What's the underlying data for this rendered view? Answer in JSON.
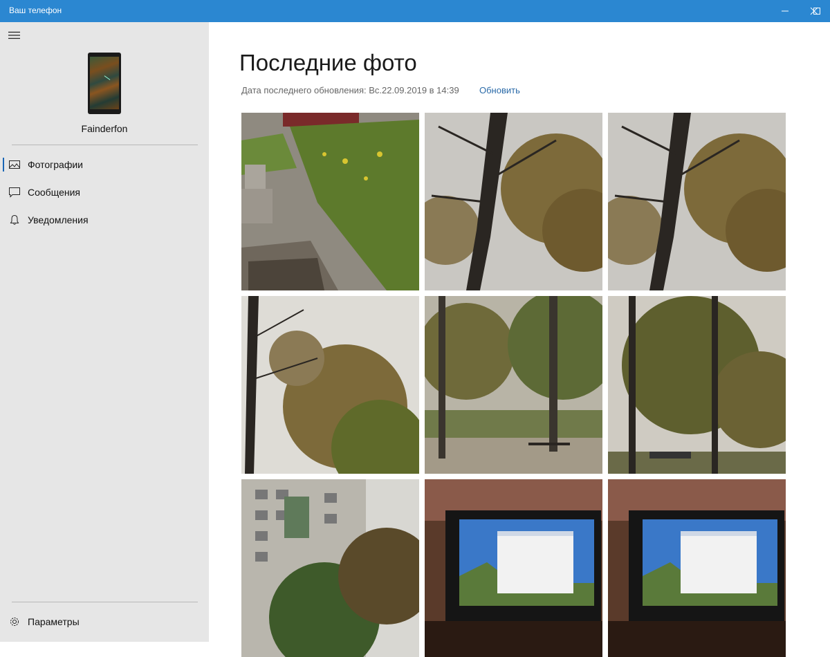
{
  "window": {
    "title": "Ваш телефон"
  },
  "sidebar": {
    "device_name": "Fainderfon",
    "items": [
      {
        "label": "Фотографии",
        "icon": "photos-icon"
      },
      {
        "label": "Сообщения",
        "icon": "messages-icon"
      },
      {
        "label": "Уведомления",
        "icon": "notifications-icon"
      }
    ],
    "settings_label": "Параметры"
  },
  "main": {
    "title": "Последние фото",
    "updated_text": "Дата последнего обновления: Вс.22.09.2019 в 14:39",
    "refresh_label": "Обновить",
    "photos": [
      {
        "scene": "yard-steps"
      },
      {
        "scene": "tree-trunk"
      },
      {
        "scene": "tree-trunk"
      },
      {
        "scene": "tree-sky"
      },
      {
        "scene": "playground"
      },
      {
        "scene": "trees-yard"
      },
      {
        "scene": "apartment-building"
      },
      {
        "scene": "monitor"
      },
      {
        "scene": "monitor"
      }
    ]
  },
  "colors": {
    "titlebar": "#2b87d1",
    "sidebar": "#e6e6e6",
    "accent": "#1a66b5",
    "link": "#2a6aa8"
  }
}
